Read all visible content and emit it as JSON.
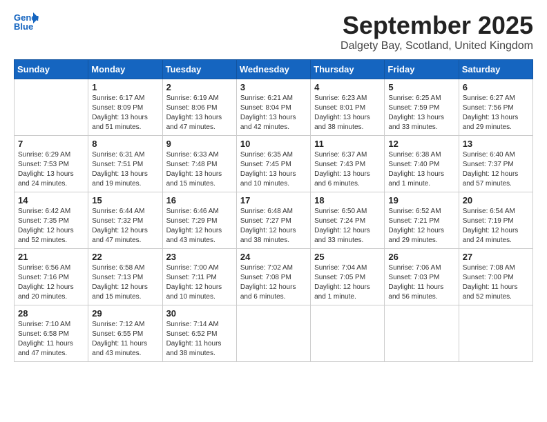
{
  "header": {
    "logo_line1": "General",
    "logo_line2": "Blue",
    "title": "September 2025",
    "subtitle": "Dalgety Bay, Scotland, United Kingdom"
  },
  "weekdays": [
    "Sunday",
    "Monday",
    "Tuesday",
    "Wednesday",
    "Thursday",
    "Friday",
    "Saturday"
  ],
  "weeks": [
    [
      {
        "day": "",
        "info": ""
      },
      {
        "day": "1",
        "info": "Sunrise: 6:17 AM\nSunset: 8:09 PM\nDaylight: 13 hours\nand 51 minutes."
      },
      {
        "day": "2",
        "info": "Sunrise: 6:19 AM\nSunset: 8:06 PM\nDaylight: 13 hours\nand 47 minutes."
      },
      {
        "day": "3",
        "info": "Sunrise: 6:21 AM\nSunset: 8:04 PM\nDaylight: 13 hours\nand 42 minutes."
      },
      {
        "day": "4",
        "info": "Sunrise: 6:23 AM\nSunset: 8:01 PM\nDaylight: 13 hours\nand 38 minutes."
      },
      {
        "day": "5",
        "info": "Sunrise: 6:25 AM\nSunset: 7:59 PM\nDaylight: 13 hours\nand 33 minutes."
      },
      {
        "day": "6",
        "info": "Sunrise: 6:27 AM\nSunset: 7:56 PM\nDaylight: 13 hours\nand 29 minutes."
      }
    ],
    [
      {
        "day": "7",
        "info": "Sunrise: 6:29 AM\nSunset: 7:53 PM\nDaylight: 13 hours\nand 24 minutes."
      },
      {
        "day": "8",
        "info": "Sunrise: 6:31 AM\nSunset: 7:51 PM\nDaylight: 13 hours\nand 19 minutes."
      },
      {
        "day": "9",
        "info": "Sunrise: 6:33 AM\nSunset: 7:48 PM\nDaylight: 13 hours\nand 15 minutes."
      },
      {
        "day": "10",
        "info": "Sunrise: 6:35 AM\nSunset: 7:45 PM\nDaylight: 13 hours\nand 10 minutes."
      },
      {
        "day": "11",
        "info": "Sunrise: 6:37 AM\nSunset: 7:43 PM\nDaylight: 13 hours\nand 6 minutes."
      },
      {
        "day": "12",
        "info": "Sunrise: 6:38 AM\nSunset: 7:40 PM\nDaylight: 13 hours\nand 1 minute."
      },
      {
        "day": "13",
        "info": "Sunrise: 6:40 AM\nSunset: 7:37 PM\nDaylight: 12 hours\nand 57 minutes."
      }
    ],
    [
      {
        "day": "14",
        "info": "Sunrise: 6:42 AM\nSunset: 7:35 PM\nDaylight: 12 hours\nand 52 minutes."
      },
      {
        "day": "15",
        "info": "Sunrise: 6:44 AM\nSunset: 7:32 PM\nDaylight: 12 hours\nand 47 minutes."
      },
      {
        "day": "16",
        "info": "Sunrise: 6:46 AM\nSunset: 7:29 PM\nDaylight: 12 hours\nand 43 minutes."
      },
      {
        "day": "17",
        "info": "Sunrise: 6:48 AM\nSunset: 7:27 PM\nDaylight: 12 hours\nand 38 minutes."
      },
      {
        "day": "18",
        "info": "Sunrise: 6:50 AM\nSunset: 7:24 PM\nDaylight: 12 hours\nand 33 minutes."
      },
      {
        "day": "19",
        "info": "Sunrise: 6:52 AM\nSunset: 7:21 PM\nDaylight: 12 hours\nand 29 minutes."
      },
      {
        "day": "20",
        "info": "Sunrise: 6:54 AM\nSunset: 7:19 PM\nDaylight: 12 hours\nand 24 minutes."
      }
    ],
    [
      {
        "day": "21",
        "info": "Sunrise: 6:56 AM\nSunset: 7:16 PM\nDaylight: 12 hours\nand 20 minutes."
      },
      {
        "day": "22",
        "info": "Sunrise: 6:58 AM\nSunset: 7:13 PM\nDaylight: 12 hours\nand 15 minutes."
      },
      {
        "day": "23",
        "info": "Sunrise: 7:00 AM\nSunset: 7:11 PM\nDaylight: 12 hours\nand 10 minutes."
      },
      {
        "day": "24",
        "info": "Sunrise: 7:02 AM\nSunset: 7:08 PM\nDaylight: 12 hours\nand 6 minutes."
      },
      {
        "day": "25",
        "info": "Sunrise: 7:04 AM\nSunset: 7:05 PM\nDaylight: 12 hours\nand 1 minute."
      },
      {
        "day": "26",
        "info": "Sunrise: 7:06 AM\nSunset: 7:03 PM\nDaylight: 11 hours\nand 56 minutes."
      },
      {
        "day": "27",
        "info": "Sunrise: 7:08 AM\nSunset: 7:00 PM\nDaylight: 11 hours\nand 52 minutes."
      }
    ],
    [
      {
        "day": "28",
        "info": "Sunrise: 7:10 AM\nSunset: 6:58 PM\nDaylight: 11 hours\nand 47 minutes."
      },
      {
        "day": "29",
        "info": "Sunrise: 7:12 AM\nSunset: 6:55 PM\nDaylight: 11 hours\nand 43 minutes."
      },
      {
        "day": "30",
        "info": "Sunrise: 7:14 AM\nSunset: 6:52 PM\nDaylight: 11 hours\nand 38 minutes."
      },
      {
        "day": "",
        "info": ""
      },
      {
        "day": "",
        "info": ""
      },
      {
        "day": "",
        "info": ""
      },
      {
        "day": "",
        "info": ""
      }
    ]
  ]
}
